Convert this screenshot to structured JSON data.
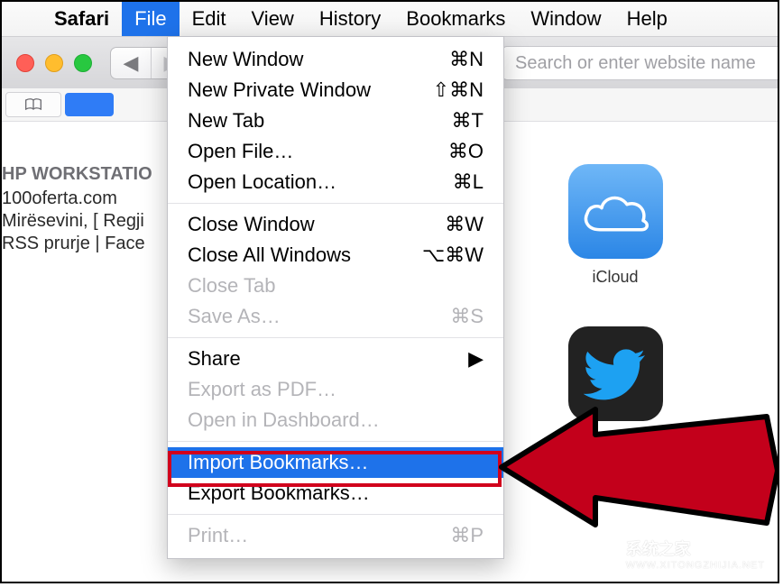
{
  "menubar": {
    "app": "Safari",
    "items": [
      "File",
      "Edit",
      "View",
      "History",
      "Bookmarks",
      "Window",
      "Help"
    ],
    "active_index": 0
  },
  "toolbar": {
    "address_placeholder": "Search or enter website name"
  },
  "sidebar": {
    "header": "HP WORKSTATIO",
    "items": [
      "100oferta.com",
      "Mirësevini, [ Regji",
      "RSS prurje | Face"
    ]
  },
  "tiles": {
    "icloud": {
      "label": "iCloud"
    },
    "twitter": {
      "label": ""
    }
  },
  "dropdown": {
    "groups": [
      [
        {
          "label": "New Window",
          "shortcut": "⌘N",
          "enabled": true
        },
        {
          "label": "New Private Window",
          "shortcut": "⇧⌘N",
          "enabled": true
        },
        {
          "label": "New Tab",
          "shortcut": "⌘T",
          "enabled": true
        },
        {
          "label": "Open File…",
          "shortcut": "⌘O",
          "enabled": true
        },
        {
          "label": "Open Location…",
          "shortcut": "⌘L",
          "enabled": true
        }
      ],
      [
        {
          "label": "Close Window",
          "shortcut": "⌘W",
          "enabled": true
        },
        {
          "label": "Close All Windows",
          "shortcut": "⌥⌘W",
          "enabled": true
        },
        {
          "label": "Close Tab",
          "shortcut": "",
          "enabled": false
        },
        {
          "label": "Save As…",
          "shortcut": "⌘S",
          "enabled": false
        }
      ],
      [
        {
          "label": "Share",
          "submenu": true,
          "enabled": true
        },
        {
          "label": "Export as PDF…",
          "shortcut": "",
          "enabled": false
        },
        {
          "label": "Open in Dashboard…",
          "shortcut": "",
          "enabled": false
        }
      ],
      [
        {
          "label": "Import Bookmarks…",
          "shortcut": "",
          "enabled": true,
          "highlight": true
        },
        {
          "label": "Export Bookmarks…",
          "shortcut": "",
          "enabled": true
        }
      ],
      [
        {
          "label": "Print…",
          "shortcut": "⌘P",
          "enabled": false
        }
      ]
    ]
  },
  "watermark": {
    "line1": "系统之家",
    "line2": "WWW.XITONGZHIJIA.NET"
  }
}
